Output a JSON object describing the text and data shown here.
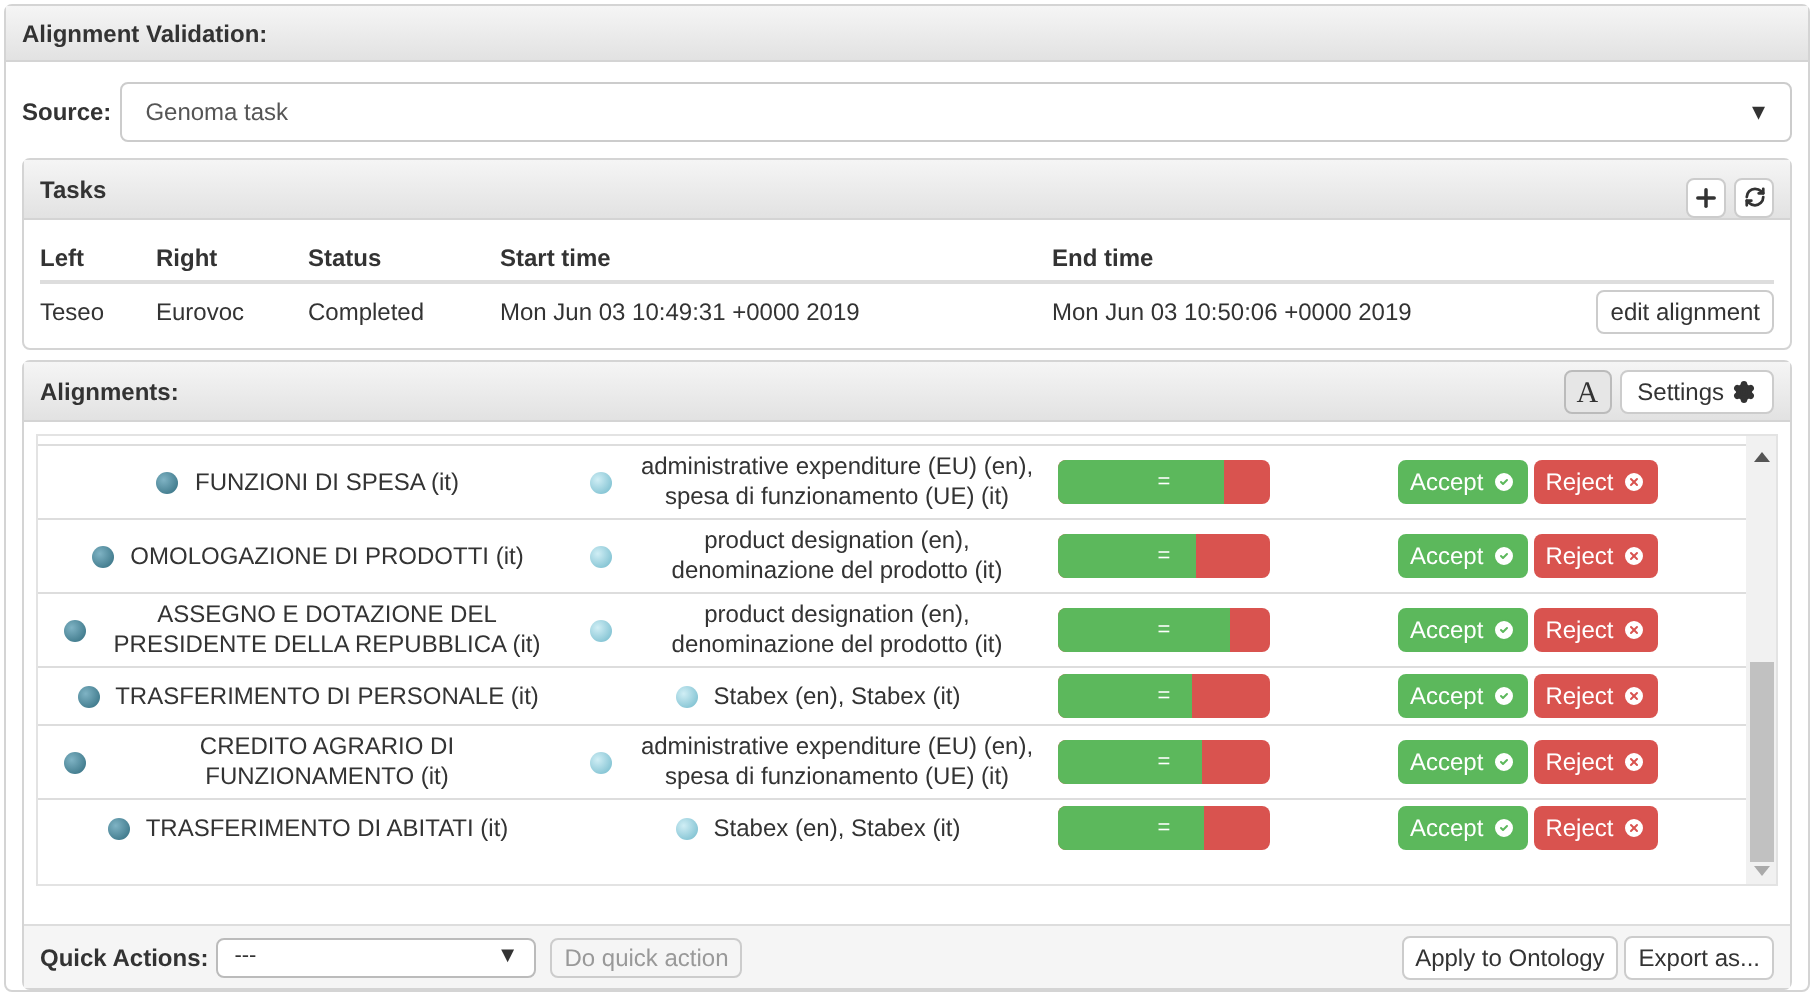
{
  "title": "Alignment Validation:",
  "source": {
    "label": "Source:",
    "value": "Genoma task",
    "caret": "▾"
  },
  "tasks": {
    "title": "Tasks",
    "columns": [
      "Left",
      "Right",
      "Status",
      "Start time",
      "End time"
    ],
    "rows": [
      {
        "cells": [
          "Teseo",
          "Eurovoc",
          "Completed",
          "Mon Jun 03 10:49:31 +0000 2019",
          "Mon Jun 03 10:50:06 +0000 2019"
        ],
        "action": "edit alignment"
      }
    ]
  },
  "alignments": {
    "title": "Alignments:",
    "font_button": "A",
    "settings": "Settings",
    "rows": [
      {
        "left": "FUNZIONI DI SPESA (it)",
        "right": "administrative expenditure (EU) (en), spesa di funzionamento (UE) (it)",
        "bar_label": "=",
        "level": 0.78,
        "accept": "Accept",
        "reject": "Reject"
      },
      {
        "left": "OMOLOGAZIONE DI PRODOTTI (it)",
        "right": "product designation (en), denominazione del prodotto (it)",
        "bar_label": "=",
        "level": 0.65,
        "accept": "Accept",
        "reject": "Reject"
      },
      {
        "left": "ASSEGNO E DOTAZIONE DEL PRESIDENTE DELLA REPUBBLICA (it)",
        "right": "product designation (en), denominazione del prodotto (it)",
        "bar_label": "=",
        "level": 0.81,
        "accept": "Accept",
        "reject": "Reject"
      },
      {
        "left": "TRASFERIMENTO DI PERSONALE (it)",
        "right": "Stabex (en), Stabex (it)",
        "bar_label": "=",
        "level": 0.63,
        "accept": "Accept",
        "reject": "Reject"
      },
      {
        "left": "CREDITO AGRARIO DI FUNZIONAMENTO (it)",
        "right": "administrative expenditure (EU) (en), spesa di funzionamento (UE) (it)",
        "bar_label": "=",
        "level": 0.68,
        "accept": "Accept",
        "reject": "Reject"
      },
      {
        "left": "TRASFERIMENTO DI ABITATI (it)",
        "right": "Stabex (en), Stabex (it)",
        "bar_label": "=",
        "level": 0.69,
        "accept": "Accept",
        "reject": "Reject"
      }
    ]
  },
  "footer": {
    "label": "Quick Actions:",
    "select_value": "---",
    "select_caret": "▼",
    "quick_button": "Do quick action",
    "quick_disabled": true,
    "buttons": [
      "Apply to Ontology",
      "Export as..."
    ]
  }
}
